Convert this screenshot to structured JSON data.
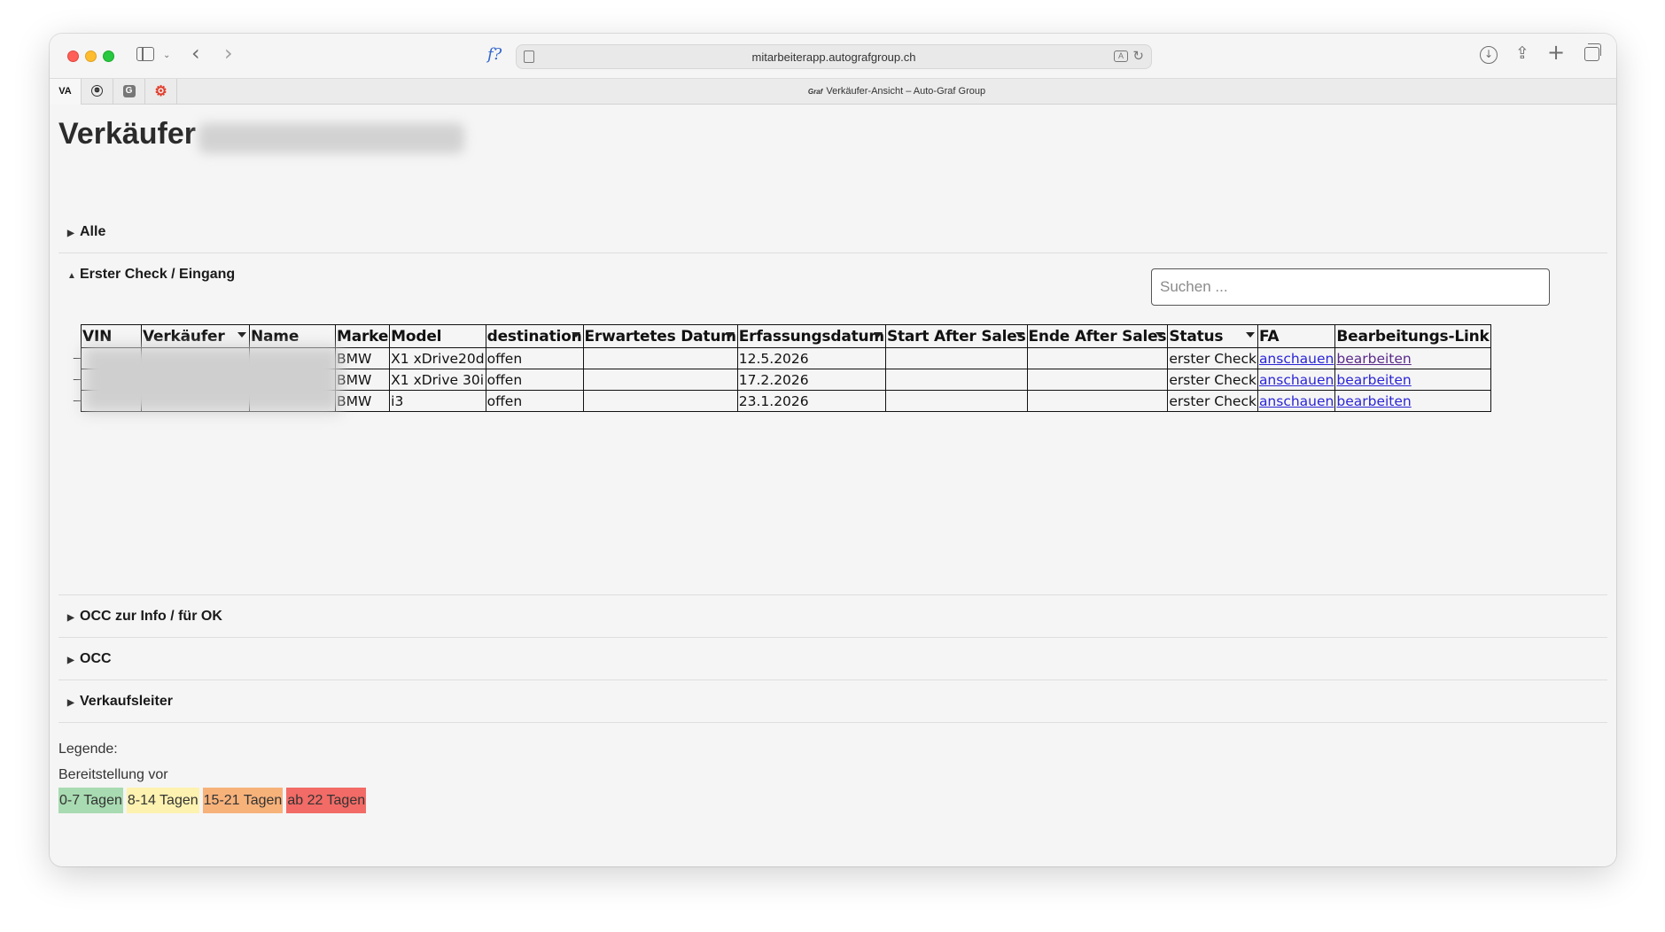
{
  "browser": {
    "url": "mitarbeiterapp.autografgroup.ch",
    "tab_title": "Verkäufer-Ansicht – Auto-Graf Group",
    "tab_favicon": "Graf",
    "fx_label": "f?",
    "pinned_tabs": [
      {
        "label": "VA",
        "icon": "va-logo-icon"
      },
      {
        "label": "⊛",
        "icon": "openai-icon"
      },
      {
        "label": "G",
        "icon": "g-app-icon"
      },
      {
        "label": "⚙",
        "icon": "gear-red-icon"
      }
    ]
  },
  "page": {
    "title": "Verkäufer",
    "sections": {
      "alle": "Alle",
      "erster": "Erster Check / Eingang",
      "occinfo": "OCC zur Info / für OK",
      "occ": "OCC",
      "vkl": "Verkaufsleiter"
    },
    "search_placeholder": "Suchen ..."
  },
  "table": {
    "headers": {
      "vin": "VIN",
      "verkaeufer": "Verkäufer",
      "name": "Name",
      "marke": "Marke",
      "model": "Model",
      "destination": "destination",
      "erwartet": "Erwartetes Datum",
      "erfassung": "Erfassungsdatum",
      "start_as": "Start After Sales",
      "ende_as": "Ende After Sales",
      "status": "Status",
      "fa": "FA",
      "link": "Bearbeitungs-Link"
    },
    "rows": [
      {
        "marke": "BMW",
        "model": "X1 xDrive20d",
        "destination": "offen",
        "erwartet": "",
        "erfassung": "12.5.2026",
        "start_as": "",
        "ende_as": "",
        "status": "erster Check",
        "fa": "anschauen",
        "link": "bearbeiten"
      },
      {
        "marke": "BMW",
        "model": "X1 xDrive 30i",
        "destination": "offen",
        "erwartet": "",
        "erfassung": "17.2.2026",
        "start_as": "",
        "ende_as": "",
        "status": "erster Check",
        "fa": "anschauen",
        "link": "bearbeiten"
      },
      {
        "marke": "BMW",
        "model": "i3",
        "destination": "offen",
        "erwartet": "",
        "erfassung": "23.1.2026",
        "start_as": "",
        "ende_as": "",
        "status": "erster Check",
        "fa": "anschauen",
        "link": "bearbeiten"
      }
    ]
  },
  "legend": {
    "title": "Legende:",
    "subtitle": "Bereitstellung vor",
    "items": [
      {
        "label": "0-7 Tagen",
        "color": "#a8dbb1"
      },
      {
        "label": "8-14 Tagen",
        "color": "#fdf2b0"
      },
      {
        "label": "15-21 Tagen",
        "color": "#f7b27a"
      },
      {
        "label": "ab 22 Tagen",
        "color": "#f26b66"
      }
    ]
  }
}
